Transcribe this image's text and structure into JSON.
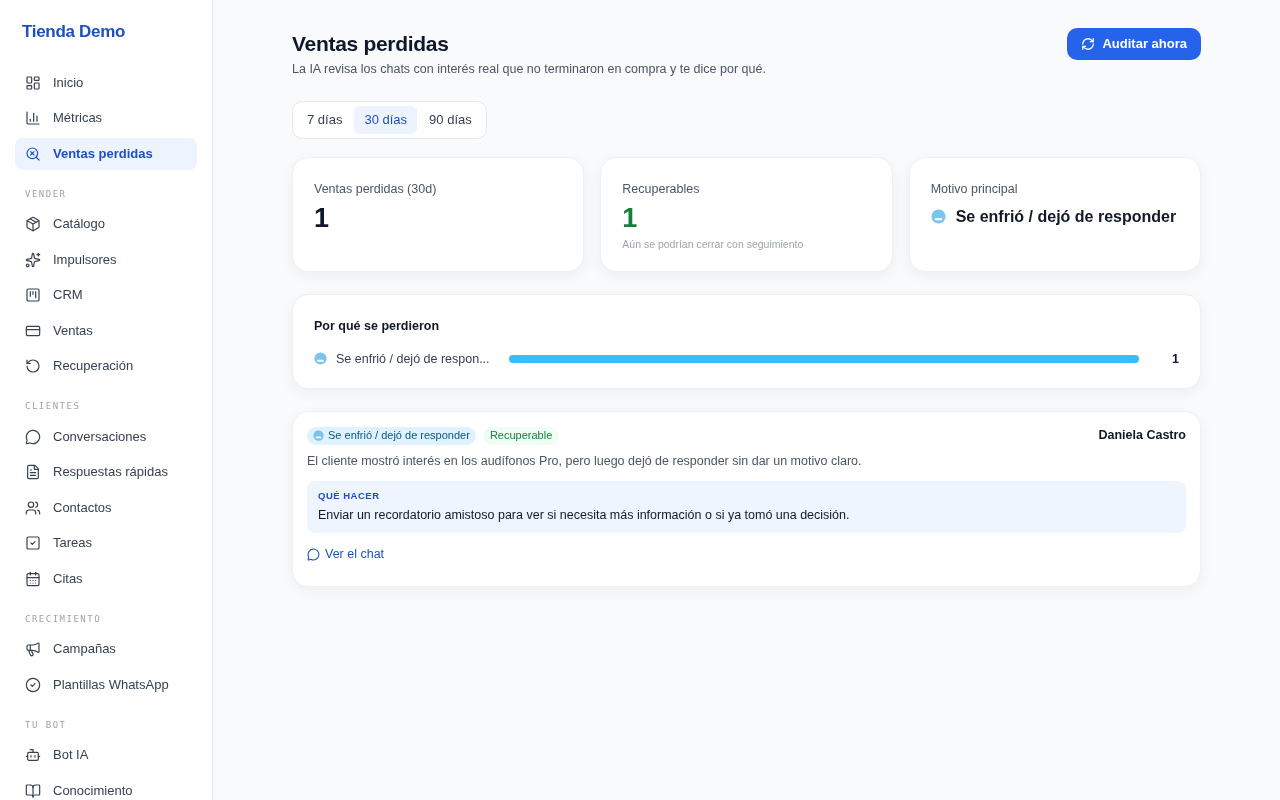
{
  "sidebar": {
    "brand": "Tienda Demo",
    "sections": [
      {
        "items": [
          {
            "label": "Inicio",
            "selected": false
          },
          {
            "label": "Métricas",
            "selected": false
          },
          {
            "label": "Ventas perdidas",
            "selected": true
          }
        ]
      },
      {
        "heading": "VENDER",
        "items": [
          {
            "label": "Catálogo",
            "selected": false
          },
          {
            "label": "Impulsores",
            "selected": false
          },
          {
            "label": "CRM",
            "selected": false
          },
          {
            "label": "Ventas",
            "selected": false
          },
          {
            "label": "Recuperación",
            "selected": false
          }
        ]
      },
      {
        "heading": "CLIENTES",
        "items": [
          {
            "label": "Conversaciones",
            "selected": false
          },
          {
            "label": "Respuestas rápidas",
            "selected": false
          },
          {
            "label": "Contactos",
            "selected": false
          },
          {
            "label": "Tareas",
            "selected": false
          },
          {
            "label": "Citas",
            "selected": false
          }
        ]
      },
      {
        "heading": "CRECIMIENTO",
        "items": [
          {
            "label": "Campañas",
            "selected": false
          },
          {
            "label": "Plantillas WhatsApp",
            "selected": false
          }
        ]
      },
      {
        "heading": "TU BOT",
        "items": [
          {
            "label": "Bot IA",
            "selected": false
          },
          {
            "label": "Conocimiento",
            "selected": false
          }
        ]
      }
    ]
  },
  "header": {
    "title": "Ventas perdidas",
    "subtitle": "La IA revisa los chats con interés real que no terminaron en compra y te dice por qué.",
    "action": "Auditar ahora"
  },
  "ranges": [
    {
      "label": "7 días",
      "selected": false
    },
    {
      "label": "30 días",
      "selected": true
    },
    {
      "label": "90 días",
      "selected": false
    }
  ],
  "stats": [
    {
      "kind": "number",
      "label": "Ventas perdidas (30d)",
      "value": "1"
    },
    {
      "kind": "positive",
      "label": "Recuperables",
      "value": "1",
      "note": "Aún se podrían cerrar con seguimiento"
    },
    {
      "kind": "reason",
      "label": "Motivo principal",
      "value": "Se enfrió / dejó de responder"
    }
  ],
  "reasons": {
    "title": "Por qué se perdieron",
    "rows": [
      {
        "label": "Se enfrió / dejó de respon...",
        "level": 1,
        "count": "1"
      }
    ]
  },
  "cases": [
    {
      "reason": "Se enfrió / dejó de responder",
      "recoverable": true,
      "status": "Recuperable",
      "customer": "Daniela Castro",
      "summary": "El cliente mostró interés en los audífonos Pro, pero luego dejó de responder sin dar un motivo claro.",
      "advice_title": "QUÉ HACER",
      "advice": "Enviar un recordatorio amistoso para ver si necesita más información o si ya tomó una decisión.",
      "link": "Ver el chat"
    }
  ]
}
